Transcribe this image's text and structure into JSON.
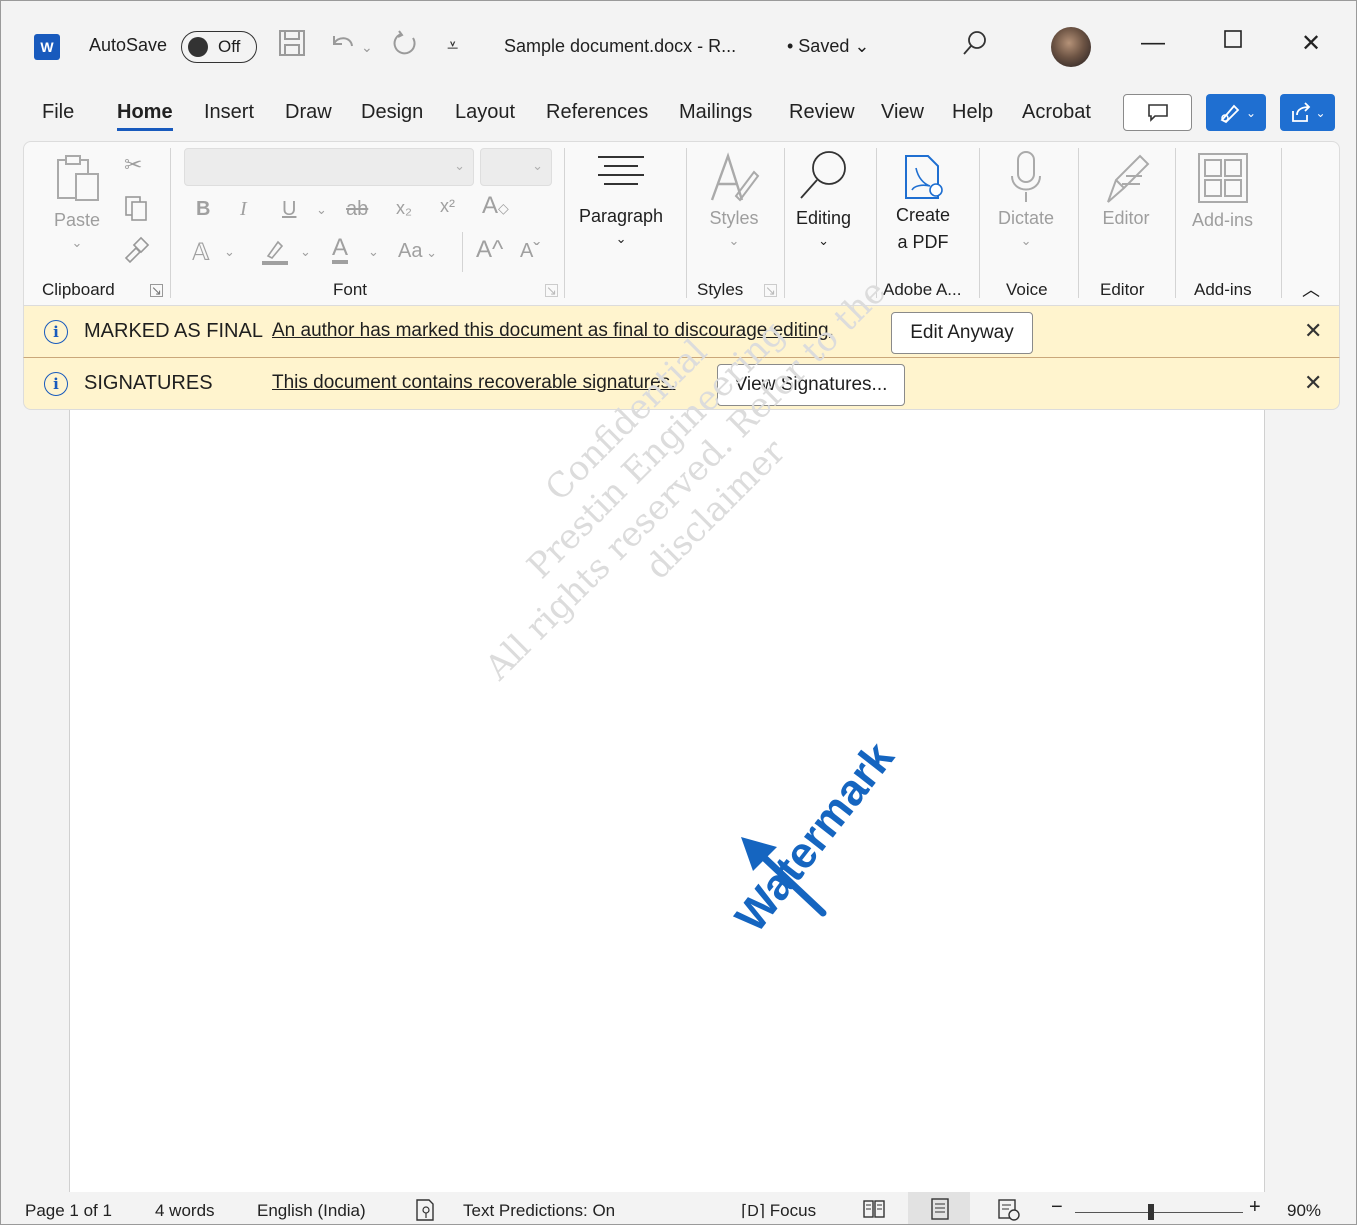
{
  "titlebar": {
    "logo_letter": "W",
    "autosave_label": "AutoSave",
    "autosave_state": "Off",
    "document_title": "Sample document.docx  -  R...",
    "saved_status": "• Saved",
    "saved_chevron": "⌄"
  },
  "tabs": [
    "File",
    "Home",
    "Insert",
    "Draw",
    "Design",
    "Layout",
    "References",
    "Mailings",
    "Review",
    "View",
    "Help",
    "Acrobat"
  ],
  "active_tab": "Home",
  "ribbon": {
    "clipboard": {
      "paste": "Paste",
      "group": "Clipboard"
    },
    "font": {
      "group": "Font",
      "bold": "B",
      "italic": "I",
      "underline": "U",
      "strike": "ab",
      "subscript": "x₂",
      "superscript": "x²",
      "case": "Aa",
      "grow": "A^",
      "shrink": "Aˇ"
    },
    "paragraph": {
      "label": "Paragraph"
    },
    "styles": {
      "label": "Styles",
      "group": "Styles"
    },
    "editing": {
      "label": "Editing"
    },
    "adobe": {
      "label_line1": "Create",
      "label_line2": "a PDF",
      "group": "Adobe A..."
    },
    "voice": {
      "label": "Dictate",
      "group": "Voice"
    },
    "editor": {
      "label": "Editor",
      "group": "Editor"
    },
    "addins": {
      "label": "Add-ins",
      "group": "Add-ins"
    }
  },
  "infobars": [
    {
      "title": "MARKED AS FINAL",
      "message": "An author has marked this document as final to discourage editing.",
      "button": "Edit Anyway"
    },
    {
      "title": "SIGNATURES",
      "message": "This document contains recoverable signatures.",
      "button": "View Signatures..."
    }
  ],
  "watermark": {
    "line1": "Confidential",
    "line2": "Prestin Engineering",
    "line3": "All rights reserved. Refer to the disclaimer"
  },
  "annotation": {
    "label": "Watermark"
  },
  "statusbar": {
    "page": "Page 1 of 1",
    "words": "4 words",
    "language": "English (India)",
    "text_predictions": "Text Predictions: On",
    "focus": "Focus",
    "zoom_minus": "−",
    "zoom_plus": "+",
    "zoom_level": "90%",
    "zoom_fraction": 0.45
  },
  "colors": {
    "accent": "#185abd",
    "infobar_bg": "#fff4ce",
    "annotation": "#1565c0"
  }
}
